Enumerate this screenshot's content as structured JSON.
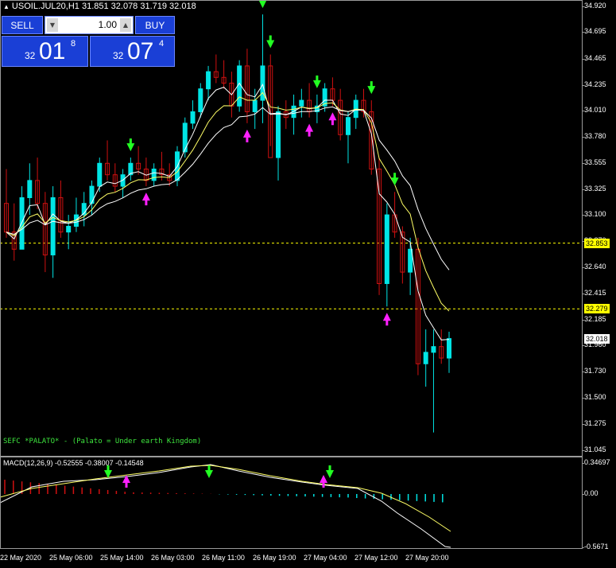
{
  "header": {
    "symbol_line": "USOIL.JUL20,H1  31.851 32.078 31.719 32.018"
  },
  "trade_panel": {
    "sell_label": "SELL",
    "buy_label": "BUY",
    "lot_value": "1.00",
    "sell_quote": {
      "prefix": "32",
      "big": "01",
      "sup": "8"
    },
    "buy_quote": {
      "prefix": "32",
      "big": "07",
      "sup": "4"
    }
  },
  "price_scale": {
    "ticks": [
      "34.920",
      "34.695",
      "34.465",
      "34.235",
      "34.010",
      "33.780",
      "33.555",
      "33.325",
      "33.100",
      "32.870",
      "32.640",
      "32.415",
      "32.185",
      "31.960",
      "31.730",
      "31.500",
      "31.275",
      "31.045"
    ],
    "badges": [
      {
        "label": "32.853",
        "style": "yellow"
      },
      {
        "label": "32.279",
        "style": "yellow"
      },
      {
        "label": "32.018",
        "style": "white"
      }
    ]
  },
  "caption": "SEFC *PALATO* - (Palato = Under earth Kingdom)",
  "macd": {
    "label": "MACD(12,26,9) -0.52555 -0.38007 -0.14548",
    "scale": [
      "0.34697",
      "0.00",
      "-0.5671"
    ]
  },
  "time_axis": [
    "22 May 2020",
    "25 May 06:00",
    "25 May 14:00",
    "26 May 03:00",
    "26 May 11:00",
    "26 May 19:00",
    "27 May 04:00",
    "27 May 12:00",
    "27 May 20:00"
  ],
  "colors": {
    "bull": "#00e5e5",
    "bear": "#d01010",
    "ma_white": "#ffffff",
    "ma_yellow": "#ffff66",
    "level": "#ffff00",
    "arrow_down": "#22ff22",
    "arrow_up": "#ff20ff",
    "panel": "#1a3fd6"
  },
  "chart_data": {
    "type": "candlestick",
    "symbol": "USOIL.JUL20",
    "timeframe": "H1",
    "ylim": [
      31.045,
      34.92
    ],
    "ohlc_last": {
      "open": 31.851,
      "high": 32.078,
      "low": 31.719,
      "close": 32.018
    },
    "candles": [
      [
        33.2,
        33.5,
        32.9,
        32.95
      ],
      [
        32.95,
        33.2,
        32.7,
        32.8
      ],
      [
        32.8,
        33.35,
        32.8,
        33.25
      ],
      [
        33.25,
        33.55,
        33.1,
        33.4
      ],
      [
        33.4,
        33.6,
        33.15,
        33.2
      ],
      [
        33.2,
        33.3,
        32.6,
        32.75
      ],
      [
        32.75,
        33.35,
        32.55,
        33.25
      ],
      [
        33.25,
        33.4,
        32.9,
        32.95
      ],
      [
        32.95,
        33.1,
        32.8,
        33.0
      ],
      [
        33.0,
        33.25,
        32.95,
        33.1
      ],
      [
        33.1,
        33.3,
        33.0,
        33.2
      ],
      [
        33.2,
        33.4,
        33.1,
        33.35
      ],
      [
        33.35,
        33.6,
        33.3,
        33.55
      ],
      [
        33.55,
        33.75,
        33.4,
        33.45
      ],
      [
        33.45,
        33.55,
        33.3,
        33.35
      ],
      [
        33.35,
        33.5,
        33.25,
        33.45
      ],
      [
        33.45,
        33.6,
        33.4,
        33.55
      ],
      [
        33.55,
        33.7,
        33.45,
        33.5
      ],
      [
        33.5,
        33.6,
        33.35,
        33.4
      ],
      [
        33.4,
        33.55,
        33.35,
        33.5
      ],
      [
        33.5,
        33.65,
        33.4,
        33.45
      ],
      [
        33.45,
        33.55,
        33.35,
        33.4
      ],
      [
        33.4,
        33.7,
        33.35,
        33.65
      ],
      [
        33.65,
        33.95,
        33.6,
        33.9
      ],
      [
        33.9,
        34.1,
        33.85,
        34.0
      ],
      [
        34.0,
        34.25,
        33.95,
        34.2
      ],
      [
        34.2,
        34.4,
        34.1,
        34.35
      ],
      [
        34.35,
        34.5,
        34.25,
        34.3
      ],
      [
        34.3,
        34.45,
        34.2,
        34.25
      ],
      [
        34.25,
        34.35,
        33.95,
        34.05
      ],
      [
        34.05,
        34.45,
        34.0,
        34.4
      ],
      [
        34.4,
        34.55,
        33.9,
        34.0
      ],
      [
        34.0,
        34.2,
        33.85,
        34.1
      ],
      [
        34.1,
        34.85,
        33.9,
        34.4
      ],
      [
        34.4,
        34.5,
        33.7,
        33.6
      ],
      [
        33.6,
        34.05,
        33.4,
        34.0
      ],
      [
        34.0,
        34.1,
        33.85,
        33.95
      ],
      [
        33.95,
        34.15,
        33.8,
        34.05
      ],
      [
        34.05,
        34.2,
        33.95,
        34.1
      ],
      [
        34.1,
        34.25,
        33.95,
        34.0
      ],
      [
        34.0,
        34.15,
        33.9,
        34.05
      ],
      [
        34.05,
        34.25,
        34.0,
        34.2
      ],
      [
        34.2,
        34.3,
        34.05,
        34.1
      ],
      [
        34.1,
        34.2,
        33.75,
        33.8
      ],
      [
        33.8,
        34.0,
        33.55,
        33.95
      ],
      [
        33.95,
        34.15,
        33.85,
        34.1
      ],
      [
        34.1,
        34.2,
        33.95,
        34.0
      ],
      [
        34.0,
        34.1,
        33.45,
        33.5
      ],
      [
        33.5,
        33.6,
        32.4,
        32.5
      ],
      [
        32.5,
        33.2,
        32.3,
        33.1
      ],
      [
        33.1,
        33.3,
        32.9,
        32.95
      ],
      [
        32.95,
        33.0,
        32.5,
        32.6
      ],
      [
        32.6,
        32.9,
        32.4,
        32.8
      ],
      [
        32.8,
        32.9,
        31.7,
        31.8
      ],
      [
        31.8,
        32.1,
        31.6,
        31.9
      ],
      [
        31.9,
        32.1,
        31.2,
        31.95
      ],
      [
        31.95,
        32.1,
        31.8,
        31.85
      ],
      [
        31.85,
        32.08,
        31.72,
        32.02
      ]
    ],
    "levels": [
      32.853,
      32.279
    ]
  }
}
